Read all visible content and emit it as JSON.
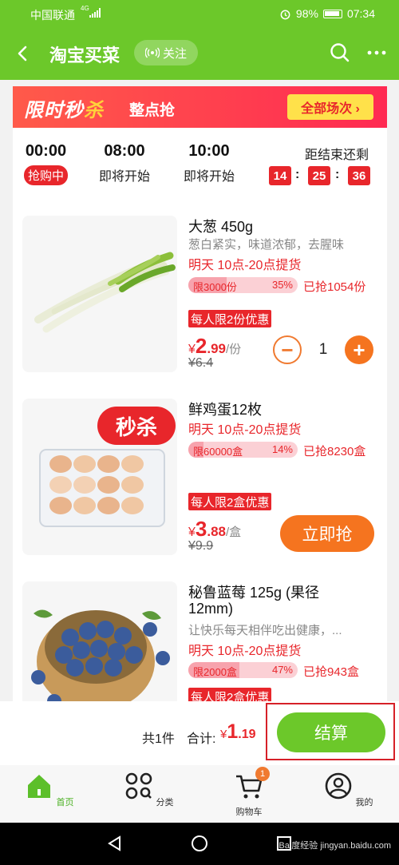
{
  "status": {
    "carrier": "中国联通",
    "net": "4G",
    "battery": "98%",
    "time": "07:34"
  },
  "header": {
    "title": "淘宝买菜",
    "follow_label": "关注"
  },
  "banner": {
    "logo_a": "限时秒",
    "logo_b": "杀",
    "subtitle": "整点抢",
    "all_sessions": "全部场次 ›"
  },
  "slots": [
    {
      "time": "00:00",
      "state": "抢购中"
    },
    {
      "time": "08:00",
      "state": "即将开始"
    },
    {
      "time": "10:00",
      "state": "即将开始"
    }
  ],
  "countdown": {
    "label": "距结束还剩",
    "h": "14",
    "m": "25",
    "s": "36"
  },
  "products": [
    {
      "name": "大葱 450g",
      "desc": "葱白紧实，味道浓郁，去腥味",
      "pickup": "明天 10点-20点提货",
      "limit_text": "限3000份",
      "limit_pct": "35%",
      "limit_fraction": 0.35,
      "sold": "已抢1054份",
      "promo": "每人限2份优惠",
      "price_cur": "¥",
      "price_int": "2",
      "price_dec": ".99",
      "price_unit": "/份",
      "orig_price": "¥6.4",
      "qty": "1"
    },
    {
      "name": "鲜鸡蛋12枚",
      "tag": "秒杀",
      "pickup": "明天 10点-20点提货",
      "limit_text": "限60000盒",
      "limit_pct": "14%",
      "limit_fraction": 0.14,
      "sold": "已抢8230盒",
      "promo": "每人限2盒优惠",
      "price_cur": "¥",
      "price_int": "3",
      "price_dec": ".88",
      "price_unit": "/盒",
      "orig_price": "¥9.9",
      "buy_label": "立即抢"
    },
    {
      "name": "秘鲁蓝莓 125g (果径",
      "name2": "12mm)",
      "desc": "让快乐每天相伴吃出健康，...",
      "pickup": "明天 10点-20点提货",
      "limit_text": "限2000盒",
      "limit_pct": "47%",
      "limit_fraction": 0.47,
      "sold": "已抢943盒",
      "promo": "每人限2盒优惠"
    }
  ],
  "checkout": {
    "count": "共1件",
    "total_label": "合计:",
    "cur": "¥",
    "int": "1",
    "dec": ".19",
    "button": "结算"
  },
  "tabs": [
    {
      "label": "首页",
      "icon": "home-icon"
    },
    {
      "label": "分类",
      "icon": "category-icon"
    },
    {
      "label": "购物车",
      "icon": "cart-icon",
      "badge": "1"
    },
    {
      "label": "我的",
      "icon": "profile-icon"
    }
  ],
  "watermark": "Bai度经验 jingyan.baidu.com",
  "colors": {
    "brand_green": "#6cc82a",
    "accent_red": "#e8262b",
    "accent_orange": "#f5741f"
  }
}
